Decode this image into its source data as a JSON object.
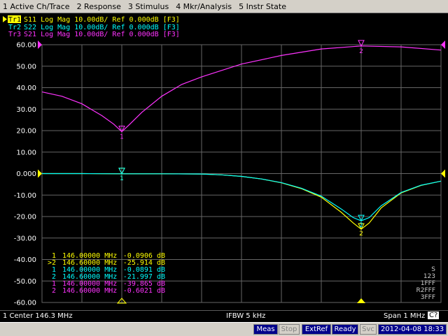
{
  "menu": [
    "1 Active Ch/Trace",
    "2 Response",
    "3 Stimulus",
    "4 Mkr/Analysis",
    "5 Instr State"
  ],
  "colors": {
    "tr1": "#ffff00",
    "tr2": "#00ffff",
    "tr3": "#ff33ff",
    "grid": "#666666",
    "axis_text": "#ffffff",
    "ref": "#ffff00"
  },
  "traces": [
    {
      "label": "Tr1",
      "text": "S11 Log Mag 10.00dB/ Ref 0.000dB [F3]",
      "active": true
    },
    {
      "label": "Tr2",
      "text": "S22 Log Mag 10.00dB/ Ref 0.000dB [F3]",
      "active": false
    },
    {
      "label": "Tr3",
      "text": "S21 Log Mag 10.00dB/ Ref 0.000dB [F3]",
      "active": false
    }
  ],
  "markers": [
    {
      "id": "1",
      "freq": "146.00000 MHz",
      "value": "-0.0906 dB",
      "trace": "tr1"
    },
    {
      "id": ">2",
      "freq": "146.60000 MHz",
      "value": "-25.914 dB",
      "trace": "tr1"
    },
    {
      "id": "1",
      "freq": "146.00000 MHz",
      "value": "-0.0891 dB",
      "trace": "tr2"
    },
    {
      "id": "2",
      "freq": "146.60000 MHz",
      "value": "-21.997 dB",
      "trace": "tr2"
    },
    {
      "id": "1",
      "freq": "146.00000 MHz",
      "value": "-39.865 dB",
      "trace": "tr3"
    },
    {
      "id": "2",
      "freq": "146.60000 MHz",
      "value": "-0.6021 dB",
      "trace": "tr3"
    }
  ],
  "right_labels": [
    "S",
    "123",
    "1FFF",
    "R2FFF",
    "3FFF"
  ],
  "chart_data": {
    "type": "line",
    "x_range": [
      145.8,
      146.8
    ],
    "ylim": [
      -60,
      60
    ],
    "yticks": [
      "60.00",
      "50.00",
      "40.00",
      "30.00",
      "20.00",
      "10.00",
      "0.000",
      "-10.00",
      "-20.00",
      "-30.00",
      "-40.00",
      "-50.00",
      "-60.00"
    ],
    "grid": true,
    "series": [
      {
        "name": "S11",
        "color": "#ffff00",
        "x": [
          145.8,
          145.9,
          146.0,
          146.1,
          146.2,
          146.25,
          146.3,
          146.35,
          146.4,
          146.45,
          146.5,
          146.55,
          146.58,
          146.6,
          146.62,
          146.65,
          146.7,
          146.75,
          146.8
        ],
        "y": [
          0,
          0,
          -0.09,
          -0.1,
          -0.2,
          -0.6,
          -1.3,
          -2.5,
          -4.3,
          -7.0,
          -11,
          -18,
          -23,
          -25.9,
          -23,
          -16,
          -9,
          -5.5,
          -3.5
        ]
      },
      {
        "name": "S22",
        "color": "#00ffff",
        "x": [
          145.8,
          145.9,
          146.0,
          146.1,
          146.2,
          146.25,
          146.3,
          146.35,
          146.4,
          146.45,
          146.5,
          146.55,
          146.58,
          146.6,
          146.62,
          146.65,
          146.7,
          146.75,
          146.8
        ],
        "y": [
          0,
          0,
          -0.09,
          -0.1,
          -0.2,
          -0.6,
          -1.3,
          -2.5,
          -4.2,
          -6.8,
          -10.5,
          -16.5,
          -20.5,
          -22.0,
          -20.5,
          -15,
          -8.8,
          -5.4,
          -3.5
        ]
      },
      {
        "name": "S21",
        "color": "#ff33ff",
        "x": [
          145.8,
          145.85,
          145.9,
          145.95,
          145.98,
          146.0,
          146.02,
          146.05,
          146.1,
          146.15,
          146.2,
          146.3,
          146.4,
          146.5,
          146.6,
          146.7,
          146.8
        ],
        "y": [
          38,
          36,
          32.5,
          27,
          23,
          19.5,
          23,
          28.5,
          36,
          41.5,
          45,
          51,
          55,
          58,
          59.4,
          59,
          57.5
        ]
      }
    ],
    "markers_on_plot": [
      {
        "trace": "S11",
        "id": "1",
        "x": 146.0,
        "y": -0.09
      },
      {
        "trace": "S11",
        "id": "2",
        "x": 146.6,
        "y": -25.9
      },
      {
        "trace": "S22",
        "id": "1",
        "x": 146.0,
        "y": -0.09
      },
      {
        "trace": "S22",
        "id": "2",
        "x": 146.6,
        "y": -22.0
      },
      {
        "trace": "S21",
        "id": "1",
        "x": 146.0,
        "y": 19.5
      },
      {
        "trace": "S21",
        "id": "2",
        "x": 146.6,
        "y": 59.4
      }
    ]
  },
  "status": {
    "center": "1  Center 146.3 MHz",
    "ifbw": "IFBW 5 kHz",
    "span": "Span 1 MHz",
    "cfix": "C?"
  },
  "bottom": {
    "meas": "Meas",
    "stop": "Stop",
    "extref": "ExtRef",
    "ready": "Ready",
    "svc": "Svc",
    "datetime": "2012-04-08 18:33"
  }
}
